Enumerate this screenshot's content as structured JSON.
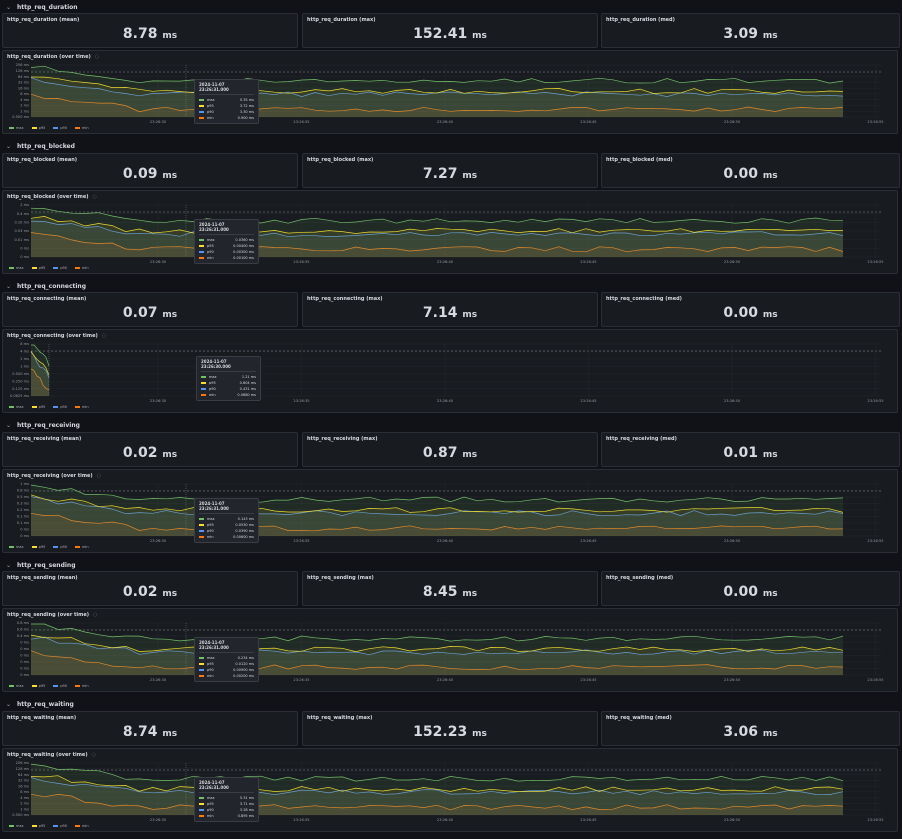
{
  "colors": {
    "max": "#73bf69",
    "p95": "#fade2a",
    "p90": "#5794f2",
    "min": "#ff780a"
  },
  "x_ticks": [
    "23:26:30",
    "23:26:35",
    "23:26:40",
    "23:26:45",
    "23:26:50",
    "23:26:55"
  ],
  "legend": [
    "max",
    "p95",
    "p90",
    "min"
  ],
  "rows": [
    {
      "title": "http_req_duration",
      "stats": [
        {
          "title": "http_req_duration (mean)",
          "value": "8.78",
          "unit": "ms"
        },
        {
          "title": "http_req_duration (max)",
          "value": "152.41",
          "unit": "ms"
        },
        {
          "title": "http_req_duration (med)",
          "value": "3.09",
          "unit": "ms"
        }
      ],
      "ts_title": "http_req_duration (over time)",
      "y_ticks": [
        "256 ms",
        "128 ms",
        "64 ms",
        "32 ms",
        "16 ms",
        "8 ms",
        "4 ms",
        "2 ms",
        "1 ms",
        "0.500 ms"
      ],
      "tooltip": {
        "time": "2024-11-07 23:26:31.000",
        "rows": [
          {
            "name": "max",
            "value": "5.35 ms"
          },
          {
            "name": "p95",
            "value": "3.72 ms"
          },
          {
            "name": "p90",
            "value": "3.30 ms"
          },
          {
            "name": "min",
            "value": "0.900 ms"
          }
        ]
      }
    },
    {
      "title": "http_req_blocked",
      "stats": [
        {
          "title": "http_req_blocked (mean)",
          "value": "0.09",
          "unit": "ms"
        },
        {
          "title": "http_req_blocked (max)",
          "value": "7.27",
          "unit": "ms"
        },
        {
          "title": "http_req_blocked (med)",
          "value": "0.00",
          "unit": "ms"
        }
      ],
      "ts_title": "http_req_blocked (over time)",
      "y_ticks": [
        "2 ms",
        "0.4 ms",
        "0.10 ms",
        "0.03 ms",
        "0.01 ms",
        "0 ms",
        "0 ms"
      ],
      "tooltip": {
        "time": "2024-11-07 23:26:31.000",
        "rows": [
          {
            "name": "max",
            "value": "0.0360 ms"
          },
          {
            "name": "p95",
            "value": "0.00400 ms"
          },
          {
            "name": "p90",
            "value": "0.00300 ms"
          },
          {
            "name": "min",
            "value": "0.00100 ms"
          }
        ]
      }
    },
    {
      "title": "http_req_connecting",
      "stats": [
        {
          "title": "http_req_connecting (mean)",
          "value": "0.07",
          "unit": "ms"
        },
        {
          "title": "http_req_connecting (max)",
          "value": "7.14",
          "unit": "ms"
        },
        {
          "title": "http_req_connecting (med)",
          "value": "0.00",
          "unit": "ms"
        }
      ],
      "ts_title": "http_req_connecting (over time)",
      "y_ticks": [
        "8 ms",
        "4 ms",
        "2 ms",
        "1 ms",
        "0.500 ms",
        "0.250 ms",
        "0.125 ms",
        "0.0625 ms"
      ],
      "tooltip": {
        "time": "2024-11-07 23:26:30.000",
        "rows": [
          {
            "name": "max",
            "value": "1.21 ms"
          },
          {
            "name": "p95",
            "value": "0.604 ms"
          },
          {
            "name": "p90",
            "value": "0.431 ms"
          },
          {
            "name": "min",
            "value": "0.0680 ms"
          }
        ]
      }
    },
    {
      "title": "http_req_receiving",
      "stats": [
        {
          "title": "http_req_receiving (mean)",
          "value": "0.02",
          "unit": "ms"
        },
        {
          "title": "http_req_receiving (max)",
          "value": "0.87",
          "unit": "ms"
        },
        {
          "title": "http_req_receiving (med)",
          "value": "0.01",
          "unit": "ms"
        }
      ],
      "ts_title": "http_req_receiving (over time)",
      "y_ticks": [
        "1 ms",
        "0.8 ms",
        "0.5 ms",
        "0.3 ms",
        "0.2 ms",
        "0.1 ms",
        "0.1 ms",
        "0 ms",
        "0 ms"
      ],
      "tooltip": {
        "time": "2024-11-07 23:26:31.000",
        "rows": [
          {
            "name": "max",
            "value": "0.143 ms"
          },
          {
            "name": "p95",
            "value": "0.0530 ms"
          },
          {
            "name": "p90",
            "value": "0.0390 ms"
          },
          {
            "name": "min",
            "value": "0.00600 ms"
          }
        ]
      }
    },
    {
      "title": "http_req_sending",
      "stats": [
        {
          "title": "http_req_sending (mean)",
          "value": "0.02",
          "unit": "ms"
        },
        {
          "title": "http_req_sending (max)",
          "value": "8.45",
          "unit": "ms"
        },
        {
          "title": "http_req_sending (med)",
          "value": "0.00",
          "unit": "ms"
        }
      ],
      "ts_title": "http_req_sending (over time)",
      "y_ticks": [
        "0.8 ms",
        "0.6 ms",
        "0.4 ms",
        "0 ms",
        "0 ms",
        "0 ms",
        "0 ms",
        "0 ms",
        "0 ms"
      ],
      "tooltip": {
        "time": "2024-11-07 23:26:31.000",
        "rows": [
          {
            "name": "max",
            "value": "0.234 ms"
          },
          {
            "name": "p95",
            "value": "0.0120 ms"
          },
          {
            "name": "p90",
            "value": "0.00900 ms"
          },
          {
            "name": "min",
            "value": "0.00200 ms"
          }
        ]
      }
    },
    {
      "title": "http_req_waiting",
      "stats": [
        {
          "title": "http_req_waiting (mean)",
          "value": "8.74",
          "unit": "ms"
        },
        {
          "title": "http_req_waiting (max)",
          "value": "152.23",
          "unit": "ms"
        },
        {
          "title": "http_req_waiting (med)",
          "value": "3.06",
          "unit": "ms"
        }
      ],
      "ts_title": "http_req_waiting (over time)",
      "y_ticks": [
        "256 ms",
        "128 ms",
        "64 ms",
        "32 ms",
        "16 ms",
        "8 ms",
        "4 ms",
        "2 ms",
        "1 ms",
        "0.500 ms"
      ],
      "tooltip": {
        "time": "2024-11-07 23:26:31.000",
        "rows": [
          {
            "name": "max",
            "value": "5.31 ms"
          },
          {
            "name": "p95",
            "value": "3.71 ms"
          },
          {
            "name": "p90",
            "value": "3.28 ms"
          },
          {
            "name": "min",
            "value": "0.895 ms"
          }
        ]
      }
    }
  ]
}
